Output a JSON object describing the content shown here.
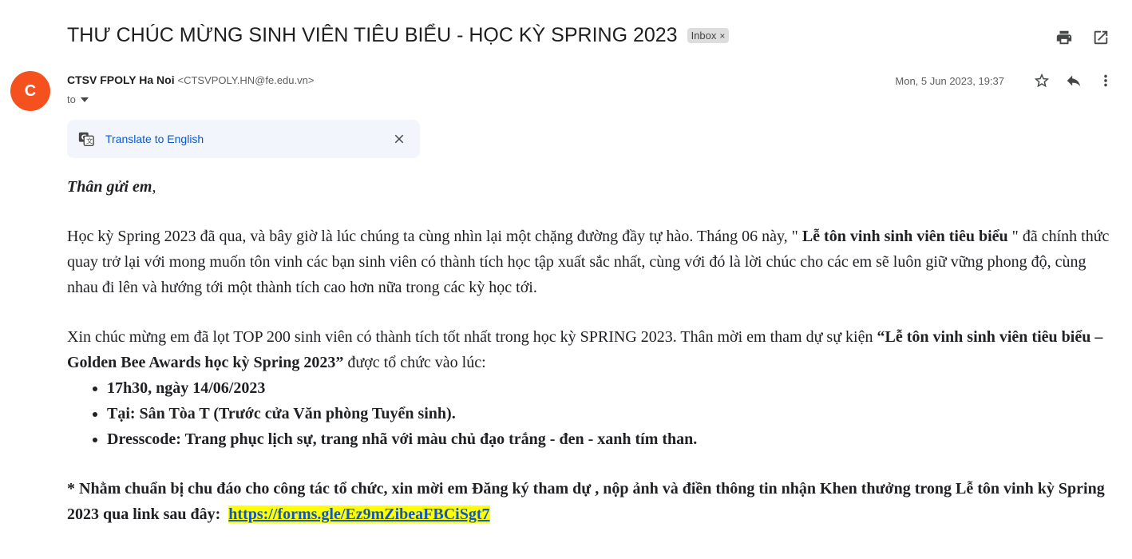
{
  "subject": "THƯ CHÚC MỪNG SINH VIÊN TIÊU BIỂU - HỌC KỲ SPRING 2023",
  "label": {
    "text": "Inbox",
    "remove": "×"
  },
  "sender": {
    "initial": "C",
    "name": "CTSV FPOLY Ha Noi",
    "email": "<CTSVPOLY.HN@fe.edu.vn>",
    "to": "to",
    "date": "Mon, 5 Jun 2023, 19:37"
  },
  "translate": {
    "label": "Translate to English"
  },
  "icons": [
    "print-icon",
    "open-in-new-window-icon",
    "star-icon",
    "reply-icon",
    "more-vert-icon",
    "translate-icon",
    "close-icon",
    "chevron-down-icon"
  ],
  "colors": {
    "avatar": "#f4511e",
    "link": "#1155cc",
    "highlight": "#ffff00",
    "translate_bg": "#f2f6fc"
  },
  "body": {
    "greeting": "Thân gửi em",
    "greeting_punct": ",",
    "p1_a": "Học kỳ Spring 2023 đã qua, và bây giờ là lúc chúng ta cùng nhìn lại một chặng đường đầy tự hào. Tháng 06 này, \" ",
    "p1_bold": "Lễ tôn vinh sinh viên tiêu biểu",
    "p1_b": " \" đã chính thức quay trở lại với mong muốn tôn vinh các bạn sinh viên có thành tích học tập xuất sắc nhất, cùng với đó là lời chúc cho các em sẽ luôn giữ vững phong độ, cùng nhau đi lên và hướng tới một thành tích cao hơn nữa trong các kỳ học tới.",
    "p2_a": "Xin chúc mừng em đã lọt TOP 200 sinh viên có thành tích tốt nhất trong học kỳ SPRING 2023. Thân mời em tham dự sự kiện ",
    "p2_bold": "“Lễ tôn vinh sinh viên tiêu biểu – Golden Bee Awards học kỳ Spring 2023”",
    "p2_b": " được tổ chức vào lúc:",
    "bullets": [
      "17h30, ngày 14/06/2023",
      "Tại: Sân Tòa T (Trước cửa Văn phòng Tuyển sinh).",
      "Dresscode:  Trang phục lịch sự, trang nhã với màu chủ đạo trắng - đen - xanh tím than."
    ],
    "p3": "* Nhằm chuẩn bị chu đáo cho công tác tổ chức, xin mời em Đăng ký tham dự , nộp ảnh và điền thông tin nhận Khen thưởng trong Lễ tôn vinh kỳ Spring 2023 qua link sau đây:",
    "link": "https://forms.gle/Ez9mZibeaFBCiSgt7"
  }
}
